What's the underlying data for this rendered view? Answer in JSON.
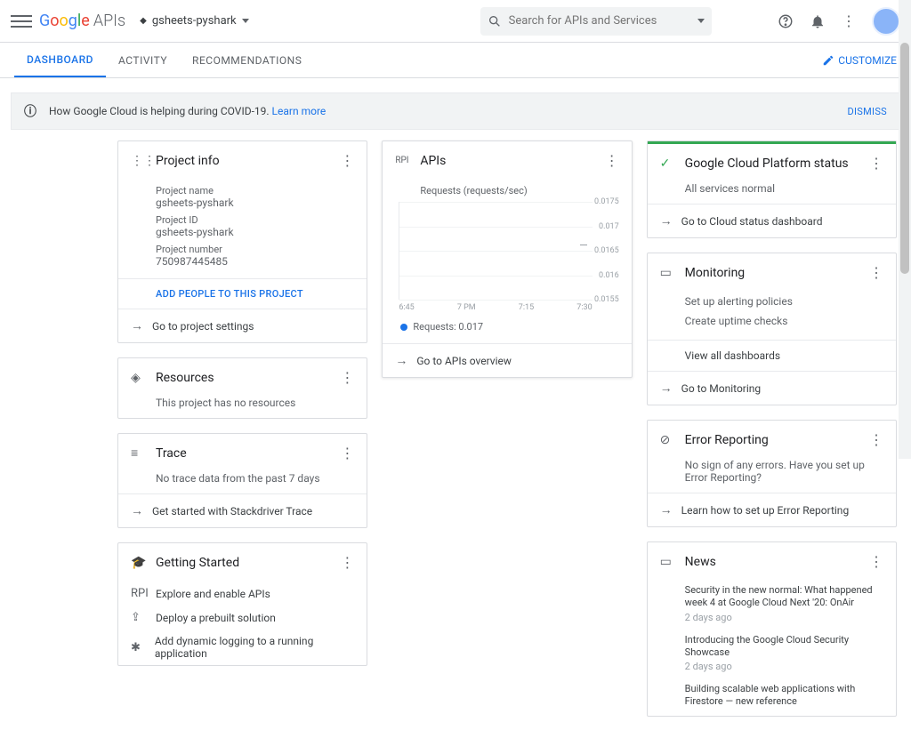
{
  "header": {
    "apis_label": "APIs",
    "project_name": "gsheets-pyshark",
    "search_placeholder": "Search for APIs and Services"
  },
  "tabs": {
    "dashboard": "DASHBOARD",
    "activity": "ACTIVITY",
    "recommendations": "RECOMMENDATIONS",
    "customize": "CUSTOMIZE"
  },
  "banner": {
    "text": "How Google Cloud is helping during COVID-19. ",
    "link": "Learn more",
    "dismiss": "DISMISS"
  },
  "project_info": {
    "title": "Project info",
    "name_label": "Project name",
    "name_value": "gsheets-pyshark",
    "id_label": "Project ID",
    "id_value": "gsheets-pyshark",
    "number_label": "Project number",
    "number_value": "750987445485",
    "add_people": "ADD PEOPLE TO THIS PROJECT",
    "settings_link": "Go to project settings"
  },
  "resources": {
    "title": "Resources",
    "empty": "This project has no resources"
  },
  "trace": {
    "title": "Trace",
    "empty": "No trace data from the past 7 days",
    "link": "Get started with Stackdriver Trace"
  },
  "getting_started": {
    "title": "Getting Started",
    "items": [
      "Explore and enable APIs",
      "Deploy a prebuilt solution",
      "Add dynamic logging to a running application"
    ]
  },
  "apis_card": {
    "title": "APIs",
    "subtitle": "Requests (requests/sec)",
    "legend": "Requests: 0.017",
    "link": "Go to APIs overview"
  },
  "chart_data": {
    "type": "line",
    "x": [
      "6:45",
      "7 PM",
      "7:15",
      "7:30"
    ],
    "yticks": [
      0.0155,
      0.016,
      0.0165,
      0.017,
      0.0175
    ],
    "series": [
      {
        "name": "Requests",
        "values": [
          0.017
        ]
      }
    ],
    "ylabel": "requests/sec"
  },
  "status": {
    "title": "Google Cloud Platform status",
    "text": "All services normal",
    "link": "Go to Cloud status dashboard"
  },
  "monitoring": {
    "title": "Monitoring",
    "alerting": "Set up alerting policies",
    "uptime": "Create uptime checks",
    "viewall": "View all dashboards",
    "link": "Go to Monitoring"
  },
  "error_reporting": {
    "title": "Error Reporting",
    "text": "No sign of any errors. Have you set up Error Reporting?",
    "link": "Learn how to set up Error Reporting"
  },
  "news": {
    "title": "News",
    "items": [
      {
        "title": "Security in the new normal: What happened week 4 at Google Cloud Next '20: OnAir",
        "date": "2 days ago"
      },
      {
        "title": "Introducing the Google Cloud Security Showcase",
        "date": "2 days ago"
      },
      {
        "title": "Building scalable web applications with Firestore — new reference",
        "date": ""
      }
    ]
  }
}
